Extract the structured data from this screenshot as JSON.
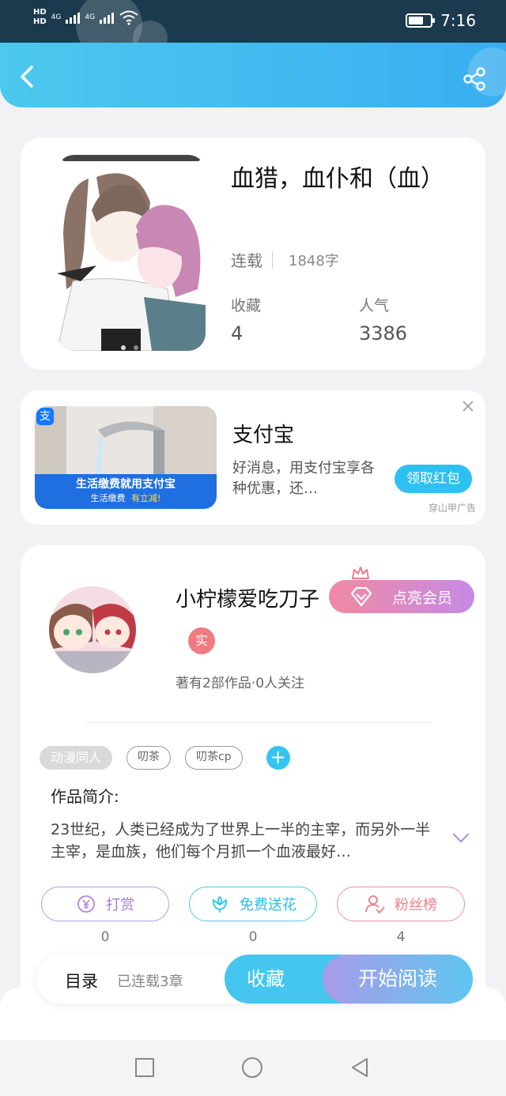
{
  "status_bar": {
    "hd1": "HD",
    "hd2": "HD",
    "net1": "4G",
    "net2": "4G",
    "time": "7:16"
  },
  "colors": {
    "header": "#39aef0",
    "accent": "#2ec0f0",
    "vip_gradient_start": "#f08aa2",
    "vip_gradient_end": "#c58ae6",
    "reward": "#b286e0",
    "flower": "#35c4f0",
    "fans": "#ef7d86"
  },
  "header": {
    "back_icon": "chevron-left-icon",
    "share_icon": "share-icon"
  },
  "book": {
    "title": "血猎，血仆和（血）",
    "status": "连载",
    "word_count": "1848字",
    "favorites_label": "收藏",
    "favorites_value": "4",
    "popularity_label": "人气",
    "popularity_value": "3386"
  },
  "ad": {
    "title": "支付宝",
    "description": "好消息，用支付宝享各种优惠，还…",
    "button": "领取红包",
    "source": "穿山甲广告",
    "banner_line1": "生活缴费就用支付宝",
    "banner_line2": "生活缴费",
    "banner_line3": "有立减!",
    "logo": "支"
  },
  "author": {
    "name": "小柠檬爱吃刀子",
    "vip_button": "点亮会员",
    "real_badge": "实",
    "works": "著有2部作品·0人关注"
  },
  "tags": {
    "category": "动漫同人",
    "items": [
      "叨茶",
      "叨茶cp"
    ],
    "add": "+"
  },
  "intro": {
    "title": "作品简介:",
    "text": "23世纪，人类已经成为了世界上一半的主宰，而另外一半主宰，是血族，他们每个月抓一个血液最好…"
  },
  "actions": [
    {
      "label": "打赏",
      "count": "0",
      "icon": "yen-coin-icon"
    },
    {
      "label": "免费送花",
      "count": "0",
      "icon": "flower-icon"
    },
    {
      "label": "粉丝榜",
      "count": "4",
      "icon": "user-rank-icon"
    }
  ],
  "bottom_bar": {
    "toc": "目录",
    "chapters": "已连载3章",
    "favorite": "收藏",
    "read": "开始阅读"
  },
  "nav": {
    "recent": "square-icon",
    "home": "circle-icon",
    "back": "triangle-icon"
  }
}
